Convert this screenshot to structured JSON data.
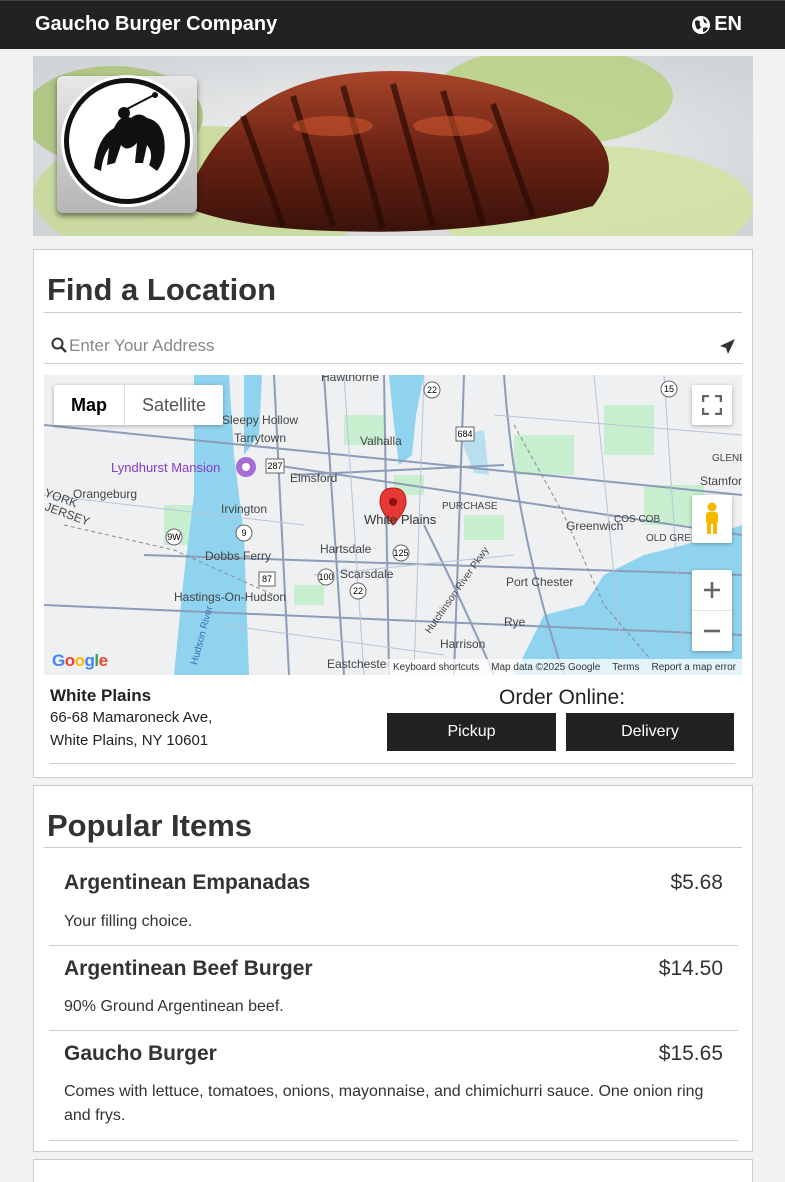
{
  "header": {
    "brand": "Gaucho Burger Company",
    "language": "EN"
  },
  "location_panel": {
    "title": "Find a Location",
    "search": {
      "placeholder": "Enter Your Address",
      "value": ""
    },
    "map": {
      "type_buttons": [
        "Map",
        "Satellite"
      ],
      "active_type": "Map",
      "labels": [
        "Hawthorne",
        "Sleepy Hollow",
        "Tarrytown",
        "Valhalla",
        "Lyndhurst Mansion",
        "Elmsford",
        "Orangeburg",
        "Irvington",
        "White Plains",
        "PURCHASE",
        "Greenwich",
        "COS COB",
        "OLD GREENWICH",
        "Stamford",
        "GLENB",
        "Dobbs Ferry",
        "Hartsdale",
        "Scarsdale",
        "Hastings-On-Hudson",
        "Port Chester",
        "Rye",
        "Harrison",
        "Eastchester",
        "Hudson River",
        "Hutchinson River Pkwy",
        "YORK",
        "JERSEY"
      ],
      "footer": [
        "Keyboard shortcuts",
        "Map data ©2025 Google",
        "Terms",
        "Report a map error"
      ],
      "attribution": "Google"
    },
    "location": {
      "name": "White Plains",
      "address_line1": "66-68 Mamaroneck Ave,",
      "address_line2": "White Plains, NY 10601"
    },
    "order": {
      "label": "Order Online:",
      "pickup": "Pickup",
      "delivery": "Delivery"
    }
  },
  "popular": {
    "title": "Popular Items",
    "items": [
      {
        "name": "Argentinean Empanadas",
        "price": "$5.68",
        "description": "Your filling choice."
      },
      {
        "name": "Argentinean Beef Burger",
        "price": "$14.50",
        "description": "90% Ground Argentinean beef."
      },
      {
        "name": "Gaucho Burger",
        "price": "$15.65",
        "description": "Comes with lettuce, tomatoes, onions, mayonnaise, and chimichurri sauce. One onion ring and frys."
      }
    ]
  },
  "colors": {
    "header_bg": "#222222",
    "button_bg": "#222222",
    "marker": "#e53935",
    "water": "#8fd3ee",
    "park": "#c7efcf"
  }
}
